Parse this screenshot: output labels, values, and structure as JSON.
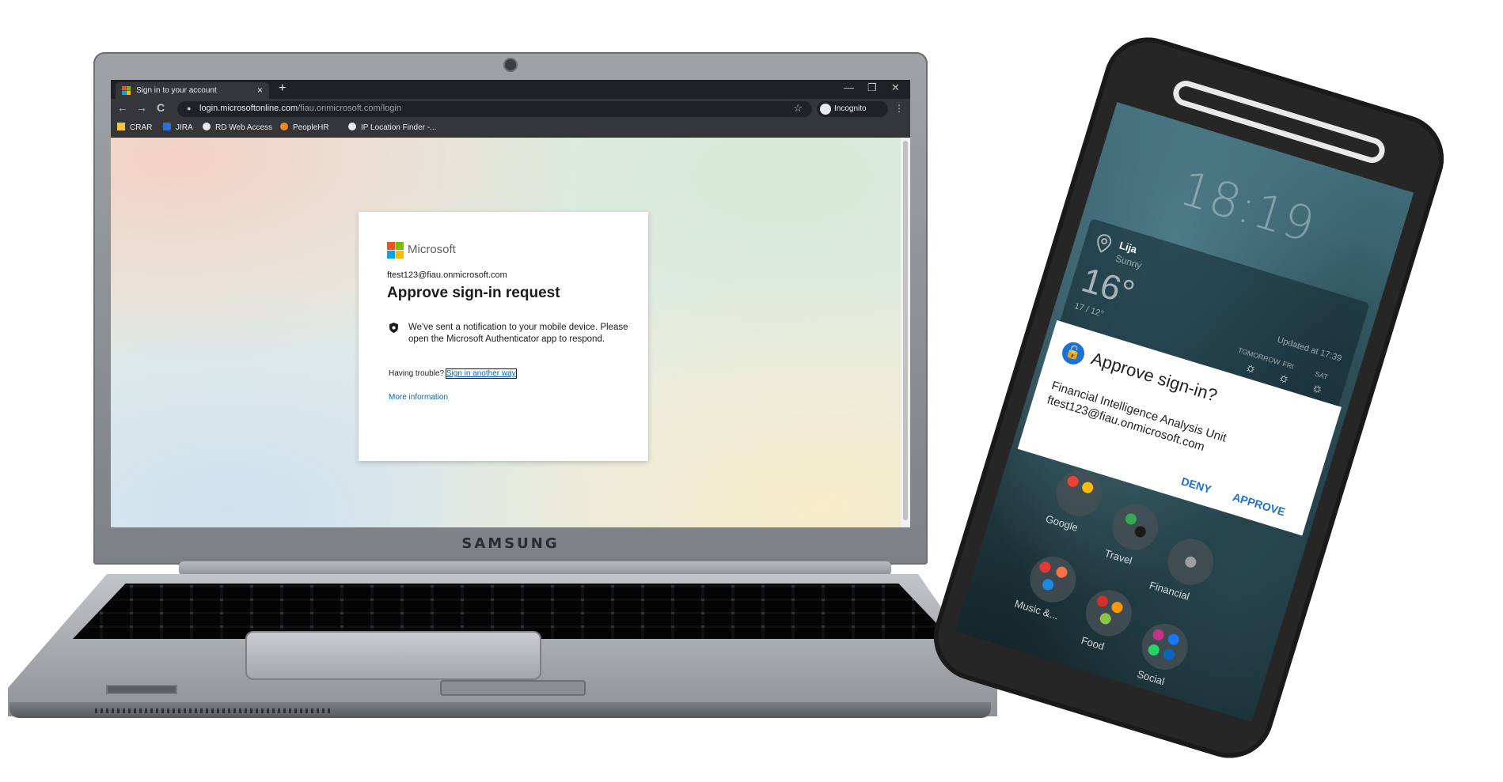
{
  "laptop": {
    "brand": "SAMSUNG"
  },
  "browser": {
    "tab": {
      "title": "Sign in to your account",
      "close": "×"
    },
    "new_tab": "+",
    "window_controls": {
      "minimize": "—",
      "maximize": "❐",
      "close": "✕"
    },
    "nav": {
      "back": "←",
      "forward": "→",
      "reload": "C"
    },
    "url_host": "login.microsoftonline.com",
    "url_path": "/fiau.onmicrosoft.com/login",
    "incognito": "Incognito",
    "menu": "⋮",
    "star": "☆",
    "bookmarks": [
      "CRAR",
      "JIRA",
      "RD Web Access",
      "PeopleHR",
      "IP Location Finder -..."
    ]
  },
  "signin": {
    "brand": "Microsoft",
    "email": "ftest123@fiau.onmicrosoft.com",
    "heading": "Approve sign-in request",
    "message": "We've sent a notification to your mobile device. Please open the Microsoft Authenticator app to respond.",
    "trouble_text": "Having trouble?",
    "trouble_link": "Sign in another way",
    "more_info": "More information"
  },
  "phone": {
    "clock": "18:19",
    "weather": {
      "city": "Lija",
      "condition": "Sunny",
      "temperature": "16°",
      "range": "17 / 12°",
      "updated": "Updated at 17:39",
      "days": [
        "TOMORROW",
        "FRI",
        "SAT"
      ]
    },
    "dialog": {
      "title": "Approve sign-in?",
      "organization": "Financial Intelligence Analysis Unit",
      "account": "ftest123@fiau.onmicrosoft.com",
      "deny": "DENY",
      "approve": "APPROVE"
    },
    "folders": [
      "Google",
      "Travel",
      "Financial",
      "Music &...",
      "Food",
      "Social"
    ]
  },
  "colors": {
    "ms_red": "#f25022",
    "ms_green": "#7fba00",
    "ms_blue": "#00a4ef",
    "ms_yellow": "#ffb900",
    "link_blue": "#0067b8",
    "authenticator_blue": "#1f6fd6"
  },
  "icons": [
    "microsoft-logo-icon",
    "lock-icon",
    "star-icon",
    "incognito-icon",
    "authenticator-icon",
    "weather-sun-icon",
    "location-pin-icon"
  ]
}
